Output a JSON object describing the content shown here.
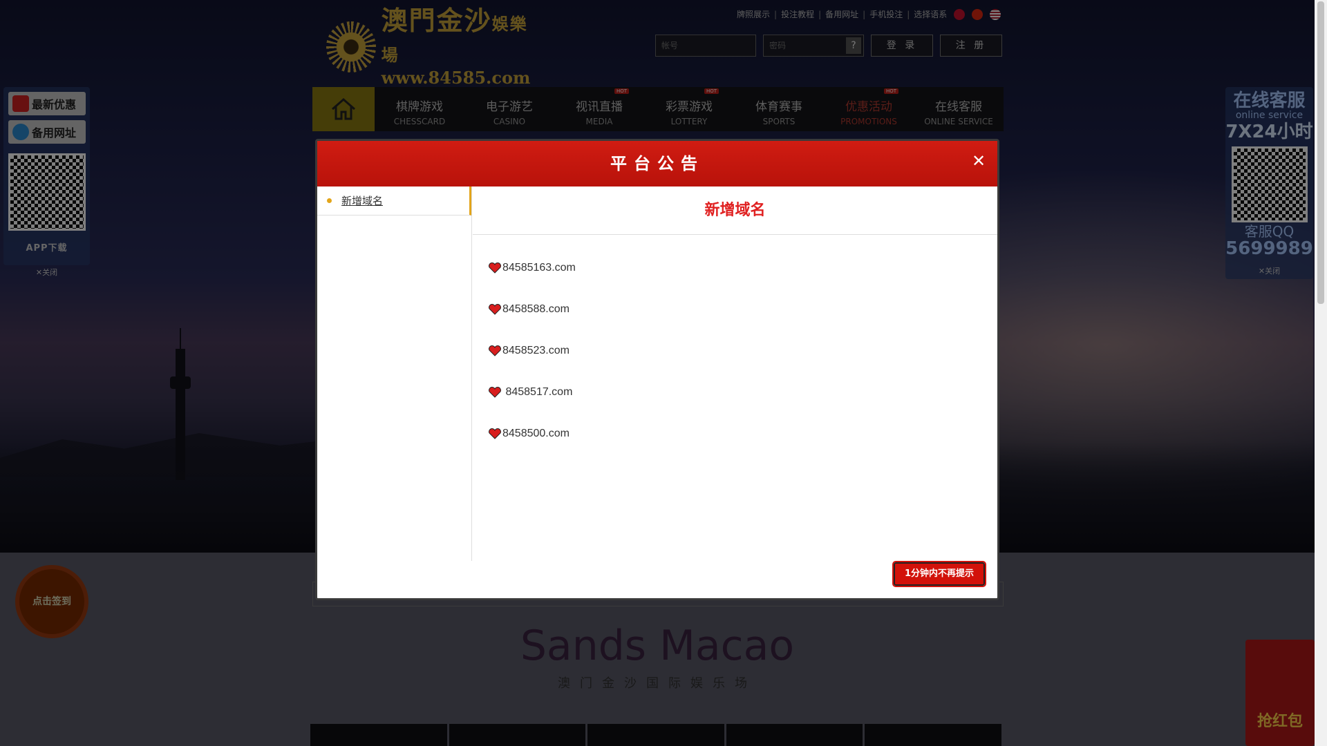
{
  "header": {
    "top_links": [
      "牌照展示",
      "投注教程",
      "备用网址",
      "手机投注",
      "选择语系"
    ],
    "logo_cn": "澳門金沙",
    "logo_cn_small": "娛樂場",
    "logo_url": "www.84585.com",
    "username_placeholder": "帐号",
    "password_placeholder": "密码",
    "help_label": "?",
    "login_label": "登 录",
    "register_label": "注 册"
  },
  "nav": {
    "items": [
      {
        "zh": "棋牌游戏",
        "en": "CHESSCARD",
        "hot": false
      },
      {
        "zh": "电子游艺",
        "en": "CASINO",
        "hot": false
      },
      {
        "zh": "视讯直播",
        "en": "MEDIA",
        "hot": true
      },
      {
        "zh": "彩票游戏",
        "en": "LOTTERY",
        "hot": true
      },
      {
        "zh": "体育赛事",
        "en": "SPORTS",
        "hot": false
      },
      {
        "zh": "优惠活动",
        "en": "PROMOTIONS",
        "hot": true
      },
      {
        "zh": "在线客服",
        "en": "ONLINE SERVICE",
        "hot": false
      }
    ],
    "hot_label": "HOT"
  },
  "left_float": {
    "promo_label": "最新优惠",
    "backup_label": "备用网址",
    "app_label": "APP下载",
    "close_label": "✕关闭"
  },
  "right_float": {
    "title": "在线客服",
    "subtitle": "online service",
    "hours": "7X24小时",
    "qq_label": "客服QQ",
    "qq_number": "5699989",
    "close_label": "✕关闭"
  },
  "signin_label": "点击签到",
  "brand": {
    "en": "Sands Macao",
    "cn": "澳门金沙国际娱乐场"
  },
  "redpacket_label": "抢红包",
  "modal": {
    "title": "平台公告",
    "close_icon": "✕",
    "tabs": [
      "新增域名"
    ],
    "heading": "新增域名",
    "domains": [
      "84585163.com",
      "8458588.com",
      "8458523.com",
      " 8458517.com",
      "8458500.com"
    ],
    "dismiss_label": "1分钟内不再提示"
  }
}
